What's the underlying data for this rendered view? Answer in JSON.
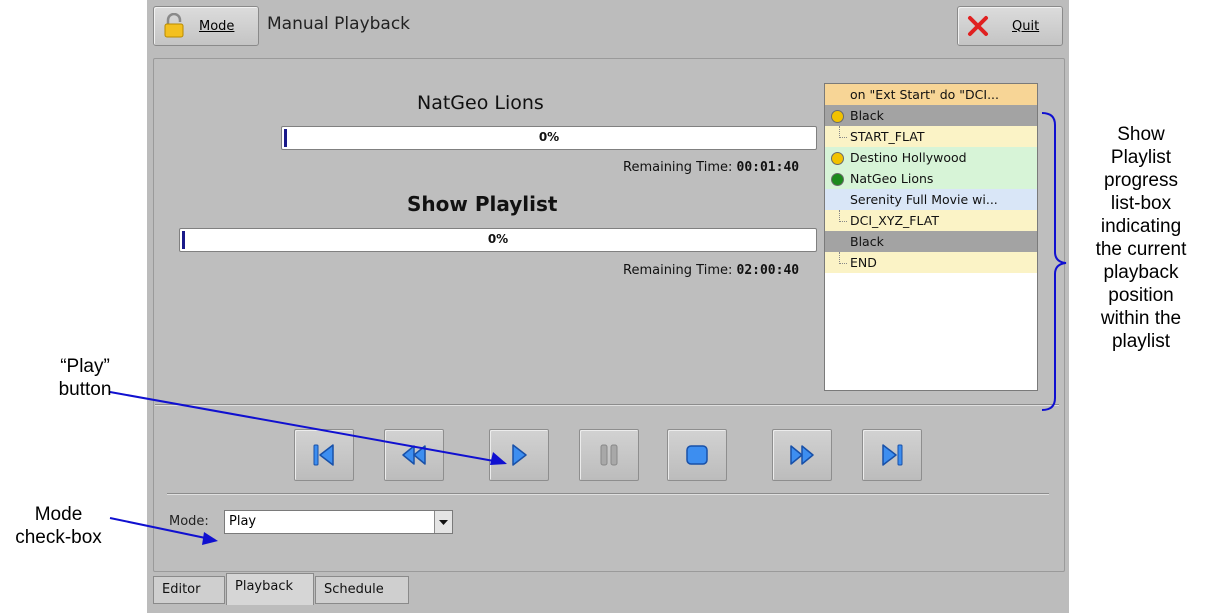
{
  "window": {
    "mode_button": {
      "label": "Mode",
      "icon": "lock-icon"
    },
    "title": "Manual Playback",
    "quit_button": {
      "label": "Quit",
      "icon": "close-icon"
    }
  },
  "current_item": {
    "title": "NatGeo Lions",
    "state": "Pause",
    "progress_percent": "0%",
    "progress_value": 0,
    "remaining_label": "Remaining Time:",
    "remaining_value": "00:01:40"
  },
  "playlist_progress": {
    "title": "Show Playlist",
    "progress_percent": "0%",
    "progress_value": 0,
    "remaining_label": "Remaining Time:",
    "remaining_value": "02:00:40"
  },
  "playlist": [
    {
      "text": "on \"Ext Start\" do \"DCI...",
      "bg": "#f7d596",
      "dot": "",
      "tree": false
    },
    {
      "text": "Black",
      "bg": "#a3a3a3",
      "dot": "#f2c200",
      "tree": false
    },
    {
      "text": "START_FLAT",
      "bg": "#fbf3c6",
      "dot": "",
      "tree": true
    },
    {
      "text": "Destino Hollywood",
      "bg": "#d7f4d7",
      "dot": "#f2c200",
      "tree": false
    },
    {
      "text": "NatGeo Lions",
      "bg": "#d7f4d7",
      "dot": "#1c8a1c",
      "tree": false
    },
    {
      "text": "Serenity Full Movie wi...",
      "bg": "#d9e6f7",
      "dot": "",
      "tree": false
    },
    {
      "text": "DCI_XYZ_FLAT",
      "bg": "#fbf3c6",
      "dot": "",
      "tree": true
    },
    {
      "text": "Black",
      "bg": "#a3a3a3",
      "dot": "",
      "tree": false
    },
    {
      "text": "END",
      "bg": "#fbf3c6",
      "dot": "",
      "tree": true
    }
  ],
  "transport": [
    {
      "name": "skip-to-start-button",
      "icon": "skip-start-icon"
    },
    {
      "name": "rewind-button",
      "icon": "rewind-icon"
    },
    {
      "name": "play-button",
      "icon": "play-icon"
    },
    {
      "name": "pause-button",
      "icon": "pause-icon"
    },
    {
      "name": "stop-button",
      "icon": "stop-icon"
    },
    {
      "name": "fast-forward-button",
      "icon": "fast-forward-icon"
    },
    {
      "name": "skip-to-end-button",
      "icon": "skip-end-icon"
    }
  ],
  "mode": {
    "label": "Mode:",
    "value": "Play"
  },
  "tabs": [
    {
      "label": "Editor",
      "active": false
    },
    {
      "label": "Playback",
      "active": true
    },
    {
      "label": "Schedule",
      "active": false
    }
  ],
  "annotations": {
    "playlist_callout": [
      "Show",
      "Playlist",
      "progress",
      "list-box",
      "indicating",
      "the current",
      "playback",
      "position",
      "within the",
      "playlist"
    ],
    "play_callout": [
      "“Play”",
      "button"
    ],
    "mode_callout": [
      "Mode",
      "check-box"
    ]
  },
  "colors": {
    "accent_blue": "#2a72d8",
    "pause_orange": "#f0a820",
    "arrow_blue": "#1010d0"
  }
}
